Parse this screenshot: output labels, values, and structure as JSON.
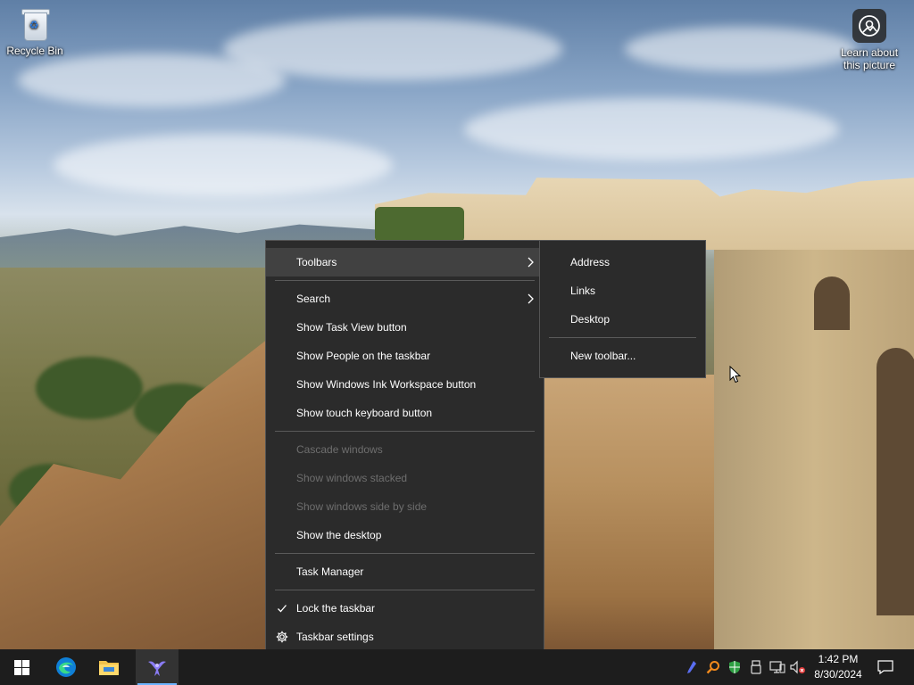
{
  "desktop": {
    "icons": [
      {
        "label": "Recycle Bin",
        "icon": "recycle-bin-icon"
      },
      {
        "label_line1": "Learn about",
        "label_line2": "this picture",
        "icon": "camera-icon"
      }
    ]
  },
  "context_menu": {
    "items": [
      {
        "label": "Toolbars",
        "highlighted": true,
        "submenu": true
      },
      {
        "label": "Search",
        "submenu": true
      },
      {
        "label": "Show Task View button"
      },
      {
        "label": "Show People on the taskbar"
      },
      {
        "label": "Show Windows Ink Workspace button"
      },
      {
        "label": "Show touch keyboard button"
      },
      {
        "label": "Cascade windows",
        "disabled": true
      },
      {
        "label": "Show windows stacked",
        "disabled": true
      },
      {
        "label": "Show windows side by side",
        "disabled": true
      },
      {
        "label": "Show the desktop"
      },
      {
        "label": "Task Manager"
      },
      {
        "label": "Lock the taskbar",
        "checked": true
      },
      {
        "label": "Taskbar settings",
        "icon": "gear-icon"
      }
    ]
  },
  "toolbars_submenu": {
    "items": [
      {
        "label": "Address"
      },
      {
        "label": "Links"
      },
      {
        "label": "Desktop"
      },
      {
        "label": "New toolbar..."
      }
    ]
  },
  "taskbar": {
    "apps": [
      "start-button",
      "edge",
      "file-explorer",
      "feedback-hub"
    ],
    "tray_icons": [
      "pen-icon",
      "search-magnifier-icon",
      "security-shield-icon",
      "usb-device-icon",
      "network-icon",
      "volume-muted-icon"
    ],
    "time": "1:42 PM",
    "date": "8/30/2024",
    "accent_color": "#6cb4ff",
    "background_color": "#1d1d1d"
  },
  "colors": {
    "menu_bg": "#2b2b2b",
    "menu_highlight": "#414141",
    "menu_disabled_text": "#6e6e6e"
  }
}
